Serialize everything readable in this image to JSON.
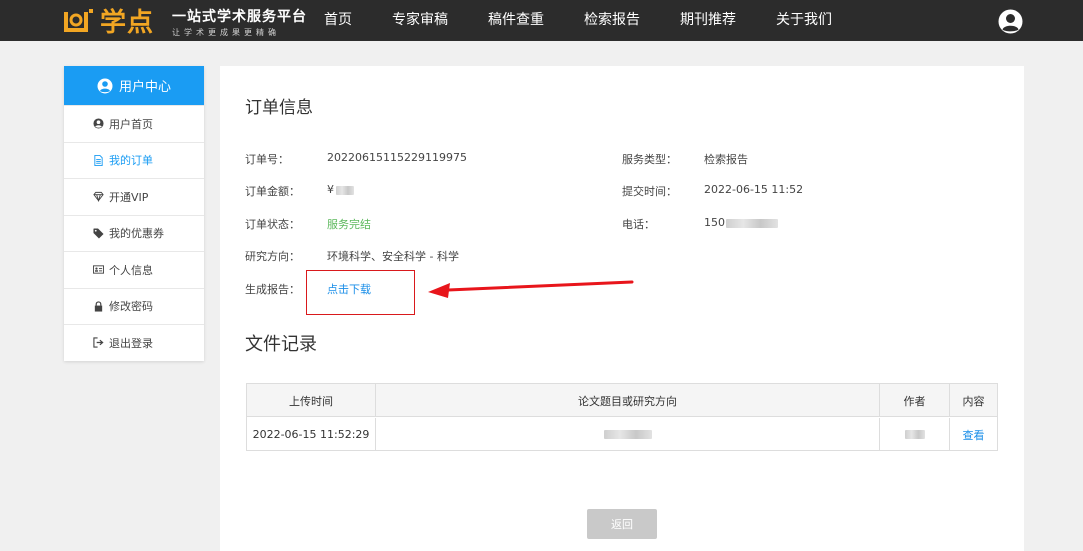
{
  "brand": {
    "name": "学点",
    "slogan": "一站式学术服务平台",
    "slogan_sub": "让学术更成果更精确",
    "accent": "#f2a623"
  },
  "nav": {
    "items": [
      "首页",
      "专家审稿",
      "稿件查重",
      "检索报告",
      "期刊推荐",
      "关于我们"
    ]
  },
  "sidebar": {
    "title": "用户中心",
    "items": [
      {
        "label": "用户首页",
        "icon": "user-circle-icon"
      },
      {
        "label": "我的订单",
        "icon": "document-icon",
        "active": true
      },
      {
        "label": "开通VIP",
        "icon": "diamond-icon"
      },
      {
        "label": "我的优惠券",
        "icon": "tag-icon"
      },
      {
        "label": "个人信息",
        "icon": "id-card-icon"
      },
      {
        "label": "修改密码",
        "icon": "lock-icon"
      },
      {
        "label": "退出登录",
        "icon": "sign-out-icon"
      }
    ],
    "accent": "#1a9cf3"
  },
  "order": {
    "title": "订单信息",
    "order_no_label": "订单号：",
    "order_no": "20220615115229119975",
    "amount_label": "订单金额：",
    "amount_prefix": "¥",
    "status_label": "订单状态：",
    "status": "服务完结",
    "research_label": "研究方向：",
    "research": "环境科学、安全科学 - 科学",
    "report_label": "生成报告：",
    "report_link": "点击下载",
    "service_type_label": "服务类型：",
    "service_type": "检索报告",
    "submit_time_label": "提交时间：",
    "submit_time": "2022-06-15 11:52",
    "phone_label": "电话：",
    "phone_prefix": "150"
  },
  "files": {
    "title": "文件记录",
    "columns": [
      "上传时间",
      "论文题目或研究方向",
      "作者",
      "内容"
    ],
    "rows": [
      {
        "time": "2022-06-15 11:52:29",
        "action": "查看"
      }
    ]
  },
  "back_button": "返回"
}
